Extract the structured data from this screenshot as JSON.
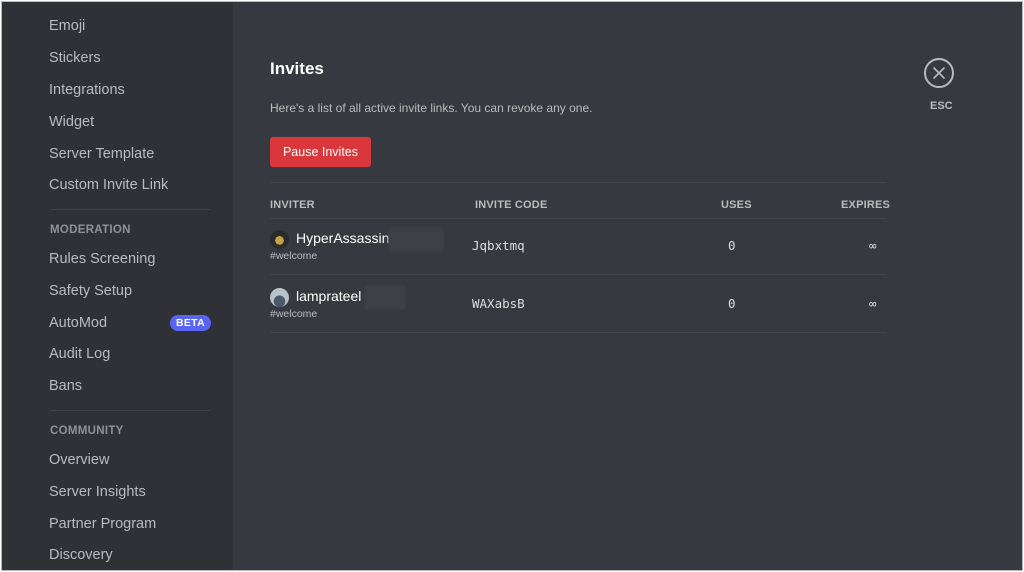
{
  "sidebar": {
    "items_top": [
      {
        "label": "Emoji"
      },
      {
        "label": "Stickers"
      },
      {
        "label": "Integrations"
      },
      {
        "label": "Widget"
      },
      {
        "label": "Server Template"
      },
      {
        "label": "Custom Invite Link"
      }
    ],
    "moderation_header": "MODERATION",
    "moderation_items": [
      {
        "label": "Rules Screening"
      },
      {
        "label": "Safety Setup"
      },
      {
        "label": "AutoMod",
        "badge": "BETA"
      },
      {
        "label": "Audit Log"
      },
      {
        "label": "Bans"
      }
    ],
    "community_header": "COMMUNITY",
    "community_items": [
      {
        "label": "Overview"
      },
      {
        "label": "Server Insights"
      },
      {
        "label": "Partner Program"
      },
      {
        "label": "Discovery"
      }
    ]
  },
  "main": {
    "title": "Invites",
    "description": "Here's a list of all active invite links. You can revoke any one.",
    "pause_button": "Pause Invites",
    "columns": {
      "inviter": "INVITER",
      "invite_code": "INVITE CODE",
      "uses": "USES",
      "expires": "EXPIRES"
    },
    "invites": [
      {
        "inviter": "HyperAssassin",
        "channel": "#welcome",
        "code": "Jqbxtmq",
        "uses": "0",
        "expires": "∞"
      },
      {
        "inviter": "lamprateel",
        "channel": "#welcome",
        "code": "WAXabsB",
        "uses": "0",
        "expires": "∞"
      }
    ],
    "esc_label": "ESC"
  },
  "colors": {
    "sidebar_bg": "#2f3136",
    "main_bg": "#36393f",
    "danger": "#da373c",
    "beta": "#5865f2"
  }
}
